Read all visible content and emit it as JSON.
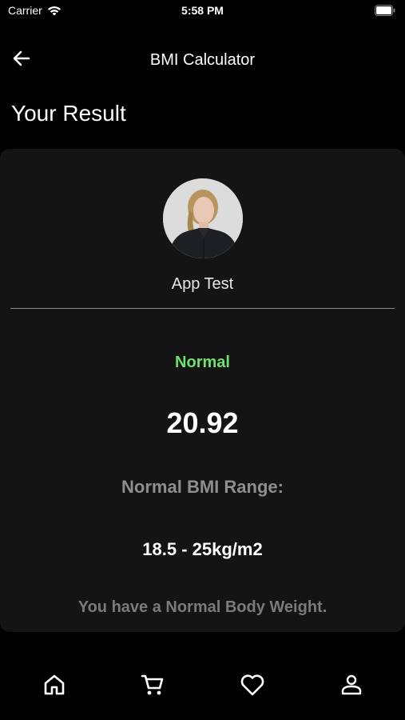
{
  "status_bar": {
    "carrier": "Carrier",
    "time": "5:58 PM"
  },
  "nav": {
    "title": "BMI Calculator",
    "back_icon": "arrow-left-icon"
  },
  "page": {
    "title": "Your Result"
  },
  "result": {
    "user_name": "App Test",
    "category": "Normal",
    "bmi_value": "20.92",
    "range_label": "Normal BMI Range:",
    "range_value": "18.5 - 25kg/m2",
    "interpretation": "You have a Normal Body Weight."
  },
  "tabs": [
    {
      "icon": "home-icon"
    },
    {
      "icon": "cart-icon"
    },
    {
      "icon": "heart-icon"
    },
    {
      "icon": "profile-icon"
    }
  ],
  "colors": {
    "background": "#000000",
    "card": "#141414",
    "normal_green": "#6ee26a",
    "muted_text": "#8e8e8e"
  }
}
